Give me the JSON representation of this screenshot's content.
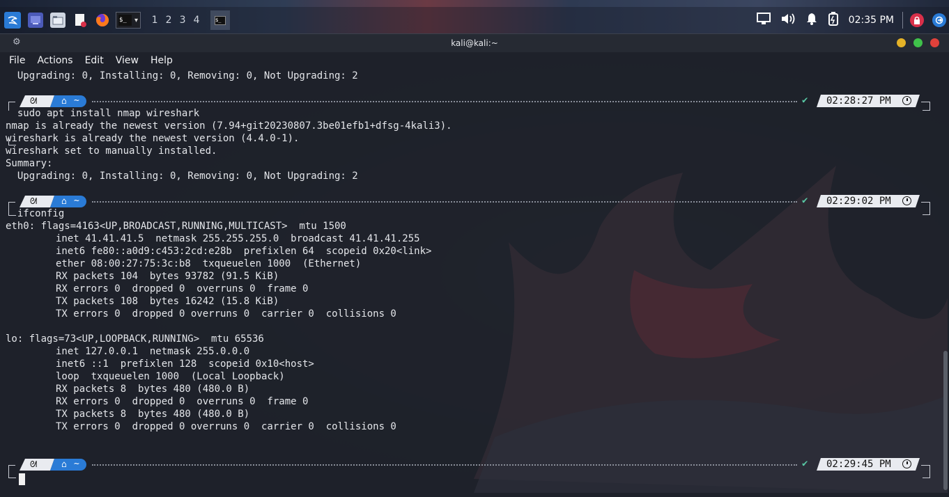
{
  "taskbar": {
    "workspaces": [
      "1",
      "2",
      "3",
      "4"
    ],
    "clock": "02:35 PM"
  },
  "window": {
    "title": "kali@kali:~",
    "buttons": {
      "minimize_color": "#e5b227",
      "maximize_color": "#3fc14a",
      "close_color": "#e0413b"
    }
  },
  "menu": [
    "File",
    "Actions",
    "Edit",
    "View",
    "Help"
  ],
  "terminal": {
    "lines": [
      "  Upgrading: 0, Installing: 0, Removing: 0, Not Upgrading: 2",
      "nmap is already the newest version (7.94+git20230807.3be01efb1+dfsg-4kali3).",
      "wireshark is already the newest version (4.4.0-1).",
      "wireshark set to manually installed.",
      "Summary:",
      "  Upgrading: 0, Installing: 0, Removing: 0, Not Upgrading: 2",
      "eth0: flags=4163<UP,BROADCAST,RUNNING,MULTICAST>  mtu 1500",
      "inet 41.41.41.5  netmask 255.255.255.0  broadcast 41.41.41.255",
      "inet6 fe80::a0d9:c453:2cd:e28b  prefixlen 64  scopeid 0x20<link>",
      "ether 08:00:27:75:3c:b8  txqueuelen 1000  (Ethernet)",
      "RX packets 104  bytes 93782 (91.5 KiB)",
      "RX errors 0  dropped 0  overruns 0  frame 0",
      "TX packets 108  bytes 16242 (15.8 KiB)",
      "TX errors 0  dropped 0 overruns 0  carrier 0  collisions 0",
      "lo: flags=73<UP,LOOPBACK,RUNNING>  mtu 65536",
      "inet 127.0.0.1  netmask 255.0.0.0",
      "inet6 ::1  prefixlen 128  scopeid 0x10<host>",
      "loop  txqueuelen 1000  (Local Loopback)",
      "RX packets 8  bytes 480 (480.0 B)",
      "RX errors 0  dropped 0  overruns 0  frame 0",
      "TX packets 8  bytes 480 (480.0 B)",
      "TX errors 0  dropped 0 overruns 0  carrier 0  collisions 0"
    ],
    "prompts": [
      {
        "dir": "~",
        "command": "sudo apt install nmap wireshark",
        "time": "02:28:27 PM"
      },
      {
        "dir": "~",
        "command": "ifconfig",
        "time": "02:29:02 PM"
      },
      {
        "dir": "~",
        "command": "",
        "time": "02:29:45 PM"
      }
    ]
  },
  "colors": {
    "accent": "#2a7bd6",
    "check": "#59c9a5"
  }
}
